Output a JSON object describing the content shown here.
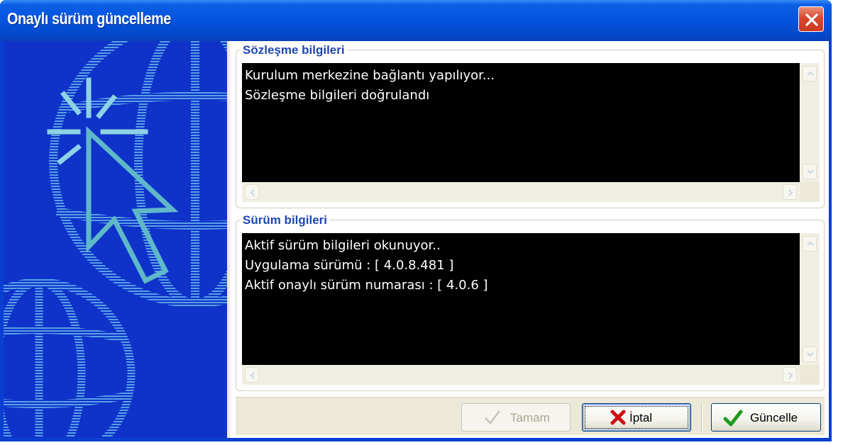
{
  "window": {
    "title": "Onaylı sürüm güncelleme"
  },
  "groups": {
    "contract": {
      "title": "Sözleşme bilgileri",
      "lines": [
        "Kurulum merkezine bağlantı yapılıyor...",
        "Sözleşme bilgileri doğrulandı"
      ]
    },
    "version": {
      "title": "Sürüm bilgileri",
      "lines": [
        "Aktif sürüm bilgileri okunuyor..",
        "Uygulama sürümü : [ 4.0.8.481 ]",
        "Aktif onaylı sürüm numarası : [ 4.0.6 ]"
      ]
    }
  },
  "buttons": {
    "ok": {
      "label": "Tamam",
      "enabled": false,
      "icon": "check-icon"
    },
    "cancel": {
      "label": "İptal",
      "enabled": true,
      "icon": "red-x-icon"
    },
    "update": {
      "label": "Güncelle",
      "enabled": true,
      "icon": "green-check-icon"
    }
  },
  "colors": {
    "title_bar": "#0653dd",
    "side_panel": "#0f33c9",
    "console_bg": "#000000",
    "console_text": "#ffffff",
    "group_title": "#1e46b0"
  }
}
